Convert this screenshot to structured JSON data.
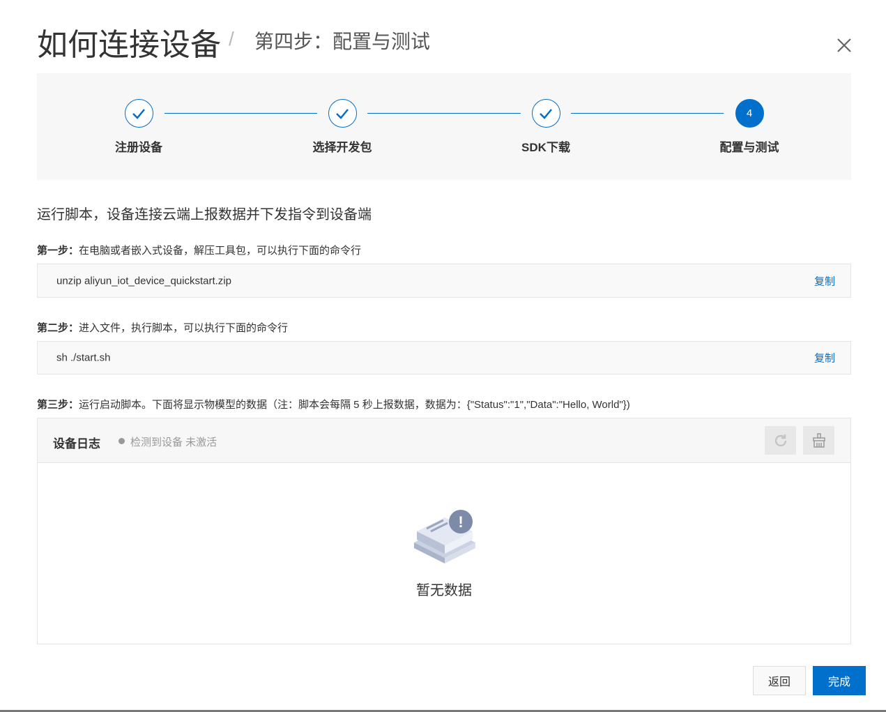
{
  "header": {
    "title": "如何连接设备",
    "separator": "/",
    "subtitle": "第四步：配置与测试"
  },
  "stepper": {
    "steps": [
      {
        "label": "注册设备",
        "state": "done"
      },
      {
        "label": "选择开发包",
        "state": "done"
      },
      {
        "label": "SDK下载",
        "state": "done"
      },
      {
        "label": "配置与测试",
        "number": "4",
        "state": "active"
      }
    ]
  },
  "main": {
    "heading": "运行脚本，设备连接云端上报数据并下发指令到设备端",
    "step1": {
      "prefix": "第一步：",
      "text": "在电脑或者嵌入式设备，解压工具包，可以执行下面的命令行",
      "command": "unzip aliyun_iot_device_quickstart.zip",
      "copy": "复制"
    },
    "step2": {
      "prefix": "第二步：",
      "text": "进入文件，执行脚本，可以执行下面的命令行",
      "command": "sh ./start.sh",
      "copy": "复制"
    },
    "step3": {
      "prefix": "第三步：",
      "text": "运行启动脚本。下面将显示物模型的数据（注：脚本会每隔 5 秒上报数据，数据为：{\"Status\":\"1\",\"Data\":\"Hello, World\"})"
    }
  },
  "log": {
    "title": "设备日志",
    "status": "检测到设备 未激活",
    "empty": "暂无数据"
  },
  "footer": {
    "back": "返回",
    "done": "完成"
  },
  "colors": {
    "accent": "#0070cc"
  }
}
